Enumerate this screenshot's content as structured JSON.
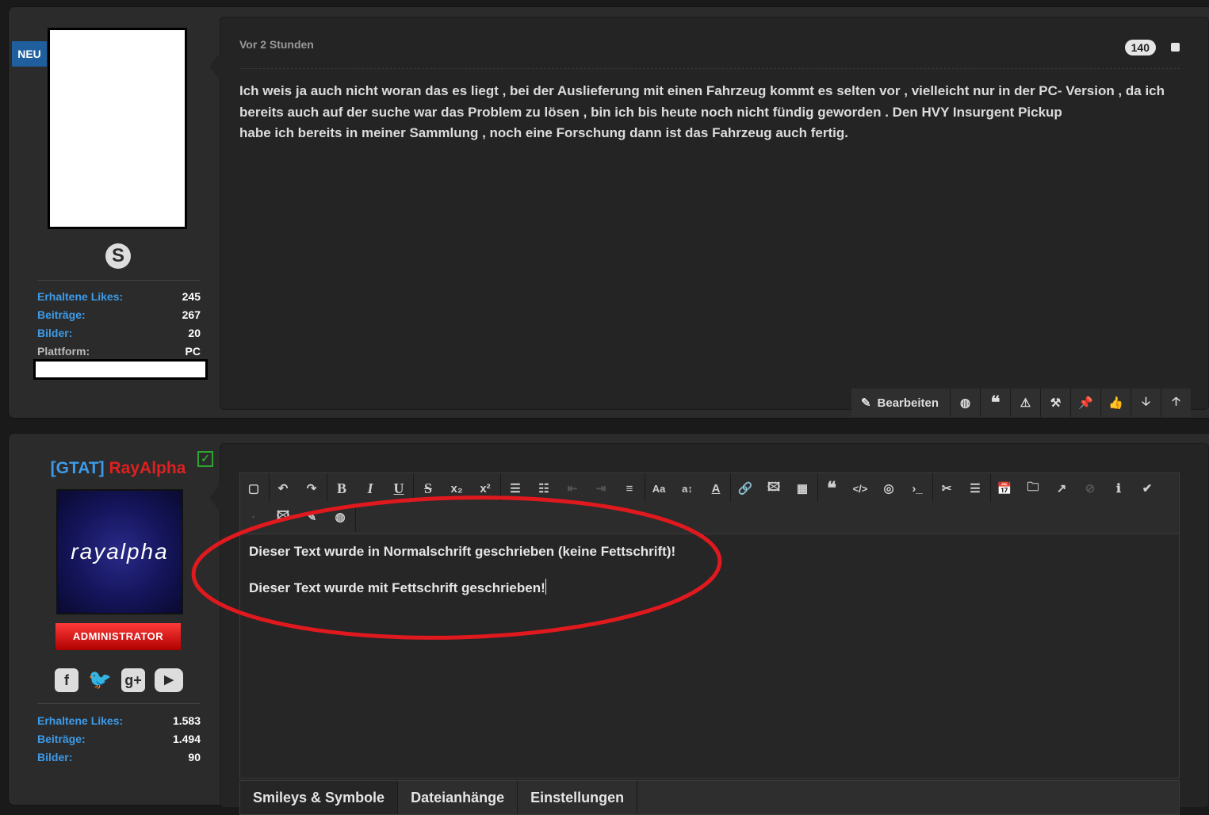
{
  "post1": {
    "neu_badge": "NEU",
    "stats": [
      {
        "label": "Erhaltene Likes",
        "value": "245"
      },
      {
        "label": "Beiträge",
        "value": "267"
      },
      {
        "label": "Bilder",
        "value": "20"
      },
      {
        "label": "Plattform",
        "value": "PC"
      }
    ],
    "time": "Vor 2 Stunden",
    "post_number": "140",
    "text_lines": [
      "Ich weis ja auch nicht woran das es liegt , bei der Auslieferung mit einen Fahrzeug kommt es selten vor , vielleicht nur in der PC- Version , da ich",
      "bereits auch auf der suche war das Problem zu lösen , bin ich bis heute noch nicht fündig geworden . Den HVY Insurgent Pickup",
      "habe ich bereits in meiner Sammlung , noch eine Forschung dann ist das Fahrzeug auch fertig."
    ],
    "actions": {
      "edit_label": "Bearbeiten",
      "icons": [
        "globe-icon",
        "quote-icon",
        "warning-icon",
        "gavel-icon",
        "thumbtack-icon",
        "thumbs-up-icon",
        "arrow-down-icon",
        "arrow-up-icon"
      ]
    }
  },
  "post2": {
    "user_tag": "[GTAT]",
    "user_name": "RayAlpha",
    "avatar_text": "rayalpha",
    "role": "ADMINISTRATOR",
    "social_icons": [
      "facebook-icon",
      "twitter-icon",
      "google-plus-icon",
      "youtube-icon"
    ],
    "stats": [
      {
        "label": "Erhaltene Likes",
        "value": "1.583"
      },
      {
        "label": "Beiträge",
        "value": "1.494"
      },
      {
        "label": "Bilder",
        "value": "90"
      }
    ],
    "editor": {
      "lines": [
        "Dieser Text wurde in Normalschrift geschrieben (keine Fettschrift)!",
        "Dieser Text wurde mit Fettschrift geschrieben!"
      ],
      "tabs": [
        "Smileys & Symbole",
        "Dateianhänge",
        "Einstellungen"
      ]
    }
  },
  "colors": {
    "accent_blue": "#3d9be9",
    "username_red": "#e02020",
    "highlight_red": "#e0191e"
  }
}
